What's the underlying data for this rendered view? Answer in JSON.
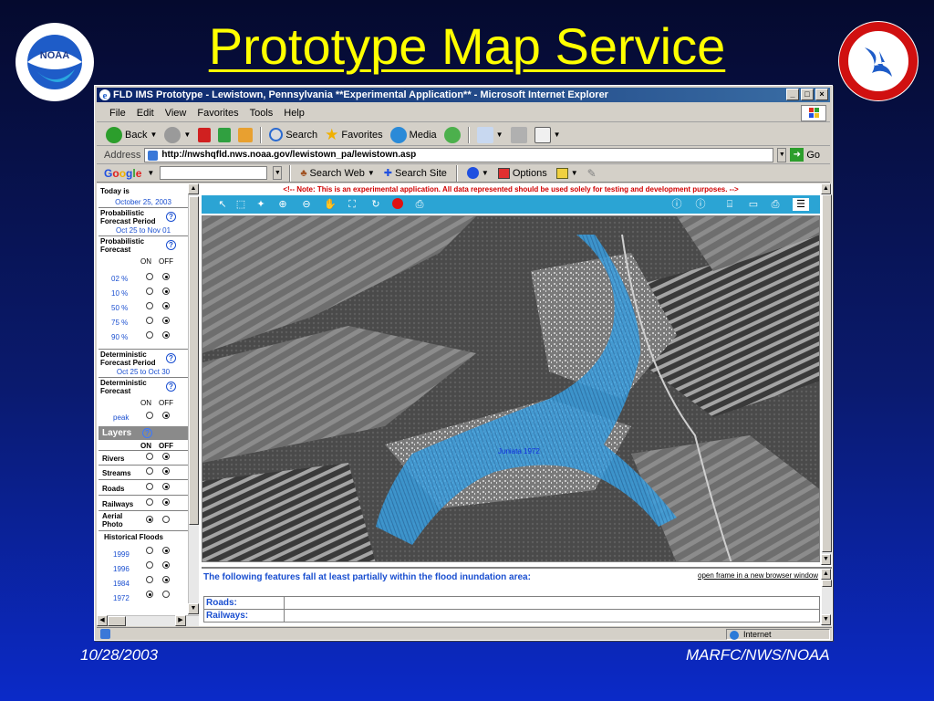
{
  "slide": {
    "title": "Prototype Map Service",
    "footer_date": "10/28/2003",
    "footer_org": "MARFC/NWS/NOAA",
    "logo_left_text": "NOAA"
  },
  "browser": {
    "window_title": "FLD IMS Prototype - Lewistown, Pennsylvania **Experimental Application** - Microsoft Internet Explorer",
    "menu": [
      "File",
      "Edit",
      "View",
      "Favorites",
      "Tools",
      "Help"
    ],
    "toolbar": {
      "back": "Back",
      "search": "Search",
      "favorites": "Favorites",
      "media": "Media"
    },
    "address_label": "Address",
    "address_value": "http://nwshqfld.nws.noaa.gov/lewistown_pa/lewistown.asp",
    "go_label": "Go",
    "google": {
      "logo": "Google",
      "search_web": "Search Web",
      "search_site": "Search Site",
      "options": "Options"
    },
    "status_zone": "Internet"
  },
  "left_panel": {
    "today_label": "Today is",
    "today_value": "October 25, 2003",
    "prob_period_label": "Probabilistic Forecast Period",
    "prob_period_value": "Oct 25 to Nov 01",
    "prob_forecast_label": "Probabilistic Forecast",
    "on_label": "ON",
    "off_label": "OFF",
    "prob_rows": [
      {
        "label": "02 %",
        "on": false
      },
      {
        "label": "10 %",
        "on": false
      },
      {
        "label": "50 %",
        "on": false
      },
      {
        "label": "75 %",
        "on": false
      },
      {
        "label": "90 %",
        "on": false
      }
    ],
    "det_period_label": "Deterministic Forecast Period",
    "det_period_value": "Oct 25 to Oct 30",
    "det_forecast_label": "Deterministic Forecast",
    "det_rows": [
      {
        "label": "peak",
        "on": false
      }
    ],
    "layers_label": "Layers",
    "layer_rows": [
      {
        "label": "Rivers",
        "on": false
      },
      {
        "label": "Streams",
        "on": false
      },
      {
        "label": "Roads",
        "on": false
      },
      {
        "label": "Railways",
        "on": false
      },
      {
        "label": "Aerial Photo",
        "on": true
      }
    ],
    "hist_label": "Historical Floods",
    "hist_rows": [
      {
        "label": "1999",
        "on": false
      },
      {
        "label": "1996",
        "on": false
      },
      {
        "label": "1984",
        "on": false
      },
      {
        "label": "1972",
        "on": true
      }
    ]
  },
  "map": {
    "note": "<!-- Note: This is an experimental application. All data represented should be used solely for testing and development purposes. -->",
    "flood_label": "Juniata 1972"
  },
  "results": {
    "title": "The following features fall at least partially within the flood inundation area:",
    "open_link": "open frame in a new browser window",
    "rows": [
      "Roads:",
      "Railways:"
    ]
  },
  "colors": {
    "title_yellow": "#ffff00",
    "flood_blue": "#3aa0e0",
    "map_toolbar": "#2ba4d4"
  }
}
